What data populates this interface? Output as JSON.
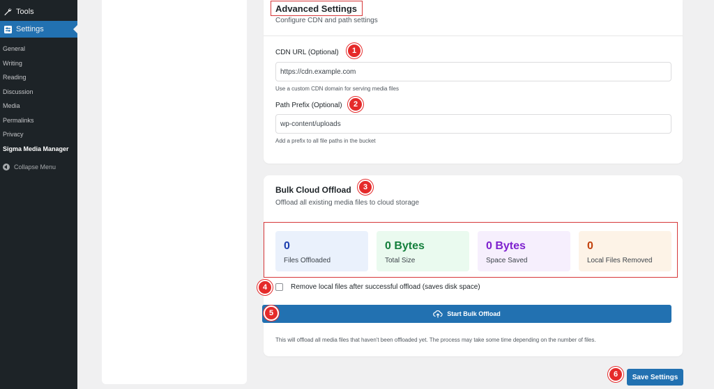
{
  "sidebar": {
    "tools_label": "Tools",
    "settings_label": "Settings",
    "submenu": [
      "General",
      "Writing",
      "Reading",
      "Discussion",
      "Media",
      "Permalinks",
      "Privacy"
    ],
    "current_item": "Sigma Media Manager",
    "collapse_label": "Collapse Menu"
  },
  "advanced": {
    "title": "Advanced Settings",
    "description": "Configure CDN and path settings",
    "cdn_label": "CDN URL (Optional)",
    "cdn_value": "https://cdn.example.com",
    "cdn_help": "Use a custom CDN domain for serving media files",
    "path_label": "Path Prefix (Optional)",
    "path_value": "wp-content/uploads",
    "path_help": "Add a prefix to all file paths in the bucket"
  },
  "bulk": {
    "title": "Bulk Cloud Offload",
    "description": "Offload all existing media files to cloud storage",
    "stats": [
      {
        "value": "0",
        "label": "Files Offloaded",
        "bg": "#eaf1fc",
        "color": "#1e40af"
      },
      {
        "value": "0 Bytes",
        "label": "Total Size",
        "bg": "#eafaef",
        "color": "#15803d"
      },
      {
        "value": "0 Bytes",
        "label": "Space Saved",
        "bg": "#f6effd",
        "color": "#7e22ce"
      },
      {
        "value": "0",
        "label": "Local Files Removed",
        "bg": "#fdf3e7",
        "color": "#c2410c"
      }
    ],
    "remove_local_label": "Remove local files after successful offload (saves disk space)",
    "button_label": "Start Bulk Offload",
    "note": "This will offload all media files that haven't been offloaded yet. The process may take some time depending on the number of files."
  },
  "save_label": "Save Settings",
  "annotations": [
    "1",
    "2",
    "3",
    "4",
    "5",
    "6"
  ],
  "colors": {
    "accent": "#2271b1",
    "annotation": "#e52a2a",
    "sidebar_bg": "#1d2327"
  }
}
